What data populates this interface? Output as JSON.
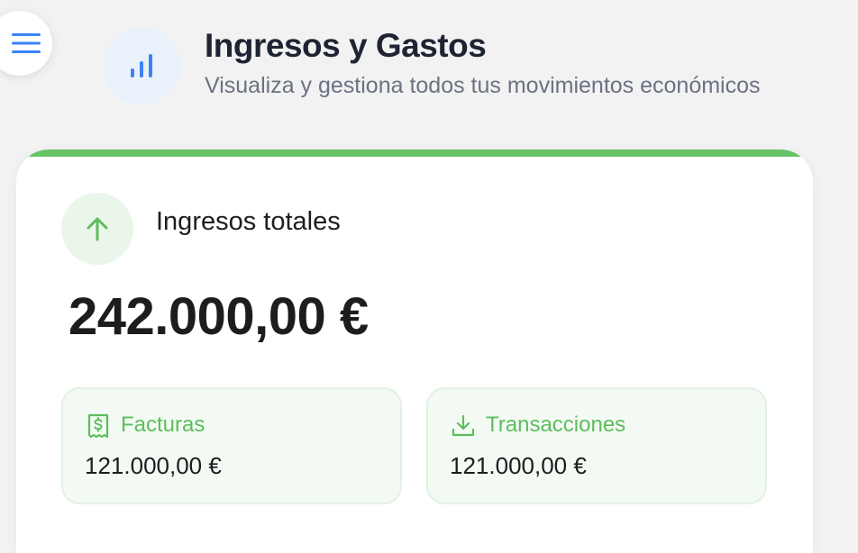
{
  "header": {
    "title": "Ingresos y Gastos",
    "subtitle": "Visualiza y gestiona todos tus movimientos económicos",
    "icon": "bar-chart-icon"
  },
  "menu": {
    "icon": "hamburger-menu-icon"
  },
  "income_card": {
    "title": "Ingresos totales",
    "total": "242.000,00 €",
    "icon": "arrow-up-icon",
    "accent_color": "#66c466",
    "stats": [
      {
        "label": "Facturas",
        "value": "121.000,00 €",
        "icon": "invoice-dollar-icon"
      },
      {
        "label": "Transacciones",
        "value": "121.000,00 €",
        "icon": "download-tray-icon"
      }
    ]
  },
  "colors": {
    "primary_blue": "#3b82f6",
    "income_green": "#5dbd5d",
    "background": "#f2f2f3"
  }
}
